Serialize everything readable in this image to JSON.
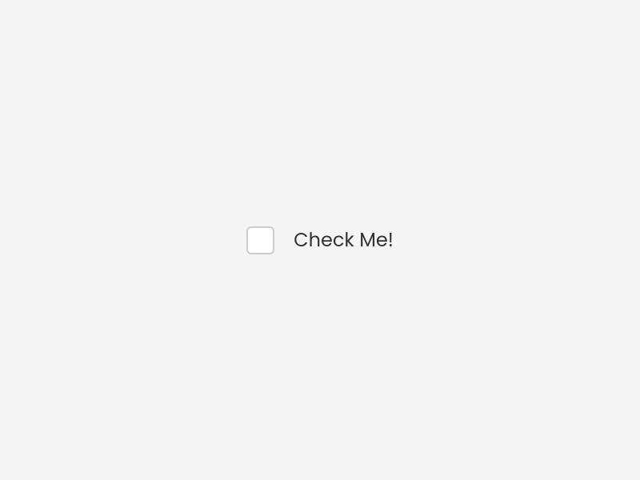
{
  "checkbox": {
    "label": "Check Me!",
    "checked": false
  }
}
